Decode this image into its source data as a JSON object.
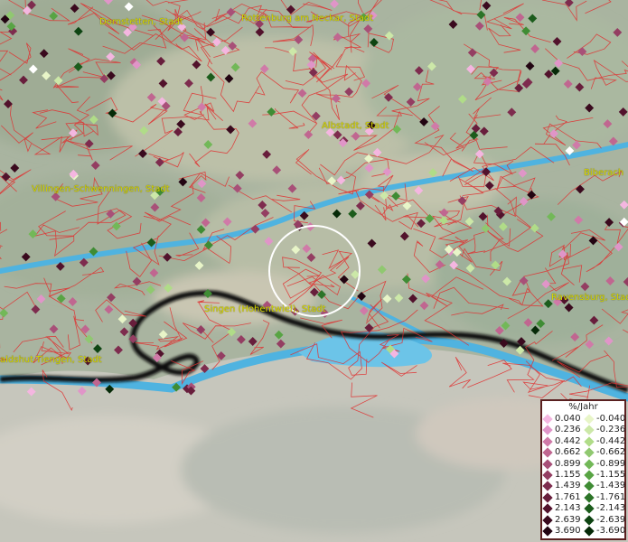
{
  "map": {
    "cities": [
      {
        "name": "Dornstetten, Stadt"
      },
      {
        "name": "Rottenburg am Neckar, Stadt"
      },
      {
        "name": "Albstadt, Stadt"
      },
      {
        "name": "Biberach"
      },
      {
        "name": "Villingen-Schwenningen, Stadt"
      },
      {
        "name": "Singen (Hohentwiel), Stadt"
      },
      {
        "name": "Ravensburg, Stad"
      },
      {
        "name": "aldshut-Tiengen, Stadt"
      }
    ],
    "colors": {
      "borders": "#e03030",
      "lake": "#4fb3e0",
      "boundary": "#111111",
      "city_label": "#d8d800",
      "highlight_circle": "#ffffff"
    }
  },
  "legend": {
    "title": "%/Jahr",
    "positive": [
      {
        "value": "0.040",
        "color": "#f4b6e0"
      },
      {
        "value": "0.236",
        "color": "#e095c8"
      },
      {
        "value": "0.442",
        "color": "#d07aa8"
      },
      {
        "value": "0.662",
        "color": "#c06690"
      },
      {
        "value": "0.899",
        "color": "#a85078"
      },
      {
        "value": "1.155",
        "color": "#943e62"
      },
      {
        "value": "1.439",
        "color": "#7e2c4e"
      },
      {
        "value": "1.761",
        "color": "#681e3c"
      },
      {
        "value": "2.143",
        "color": "#52122c"
      },
      {
        "value": "2.639",
        "color": "#3a0a1e"
      },
      {
        "value": "3.690",
        "color": "#220512"
      }
    ],
    "negative": [
      {
        "value": "-0.040",
        "color": "#e8f5c8"
      },
      {
        "value": "-0.236",
        "color": "#cce8a8"
      },
      {
        "value": "-0.442",
        "color": "#b0dc88"
      },
      {
        "value": "-0.662",
        "color": "#90c870"
      },
      {
        "value": "-0.899",
        "color": "#72b858"
      },
      {
        "value": "-1.155",
        "color": "#58a444"
      },
      {
        "value": "-1.439",
        "color": "#3f8c34"
      },
      {
        "value": "-1.761",
        "color": "#2c7428"
      },
      {
        "value": "-2.143",
        "color": "#1c5c1c"
      },
      {
        "value": "-2.639",
        "color": "#0e4412"
      },
      {
        "value": "-3.690",
        "color": "#062a08"
      }
    ]
  }
}
